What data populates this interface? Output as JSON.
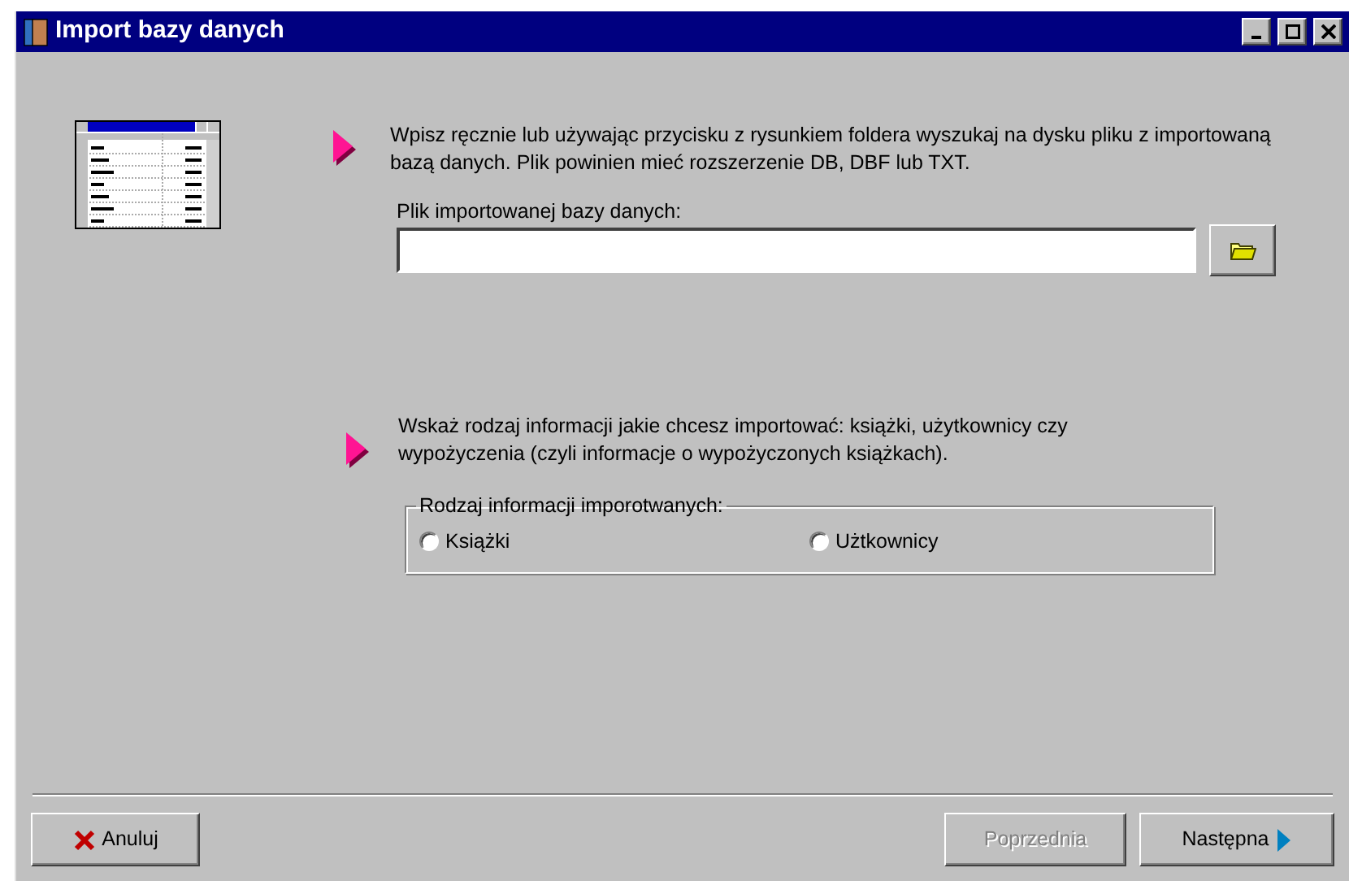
{
  "window": {
    "title": "Import bazy danych"
  },
  "step_1": {
    "instruction": "Wpisz ręcznie lub używając przycisku z rysunkiem foldera wyszukaj na dysku pliku z importowaną bazą danych. Plik powinien mieć rozszerzenie DB, DBF lub TXT.",
    "field_label": "Plik importowanej bazy danych:"
  },
  "step_2": {
    "instruction": "Wskaż rodzaj informacji jakie chcesz importować: książki, użytkownicy czy wypożyczenia (czyli informacje o wypożyczonych książkach).",
    "group_label": "Rodzaj informacji imporotwanych:",
    "options": [
      {
        "label": "Książki",
        "selected": false
      },
      {
        "label": "Użtkownicy",
        "selected": false
      }
    ]
  },
  "buttons": [
    {
      "label": "Anuluj",
      "kind": "cancel",
      "disabled": false
    },
    {
      "label": "Poprzednia",
      "kind": "back",
      "disabled": true
    },
    {
      "label": "Następna",
      "kind": "next",
      "disabled": false
    }
  ]
}
